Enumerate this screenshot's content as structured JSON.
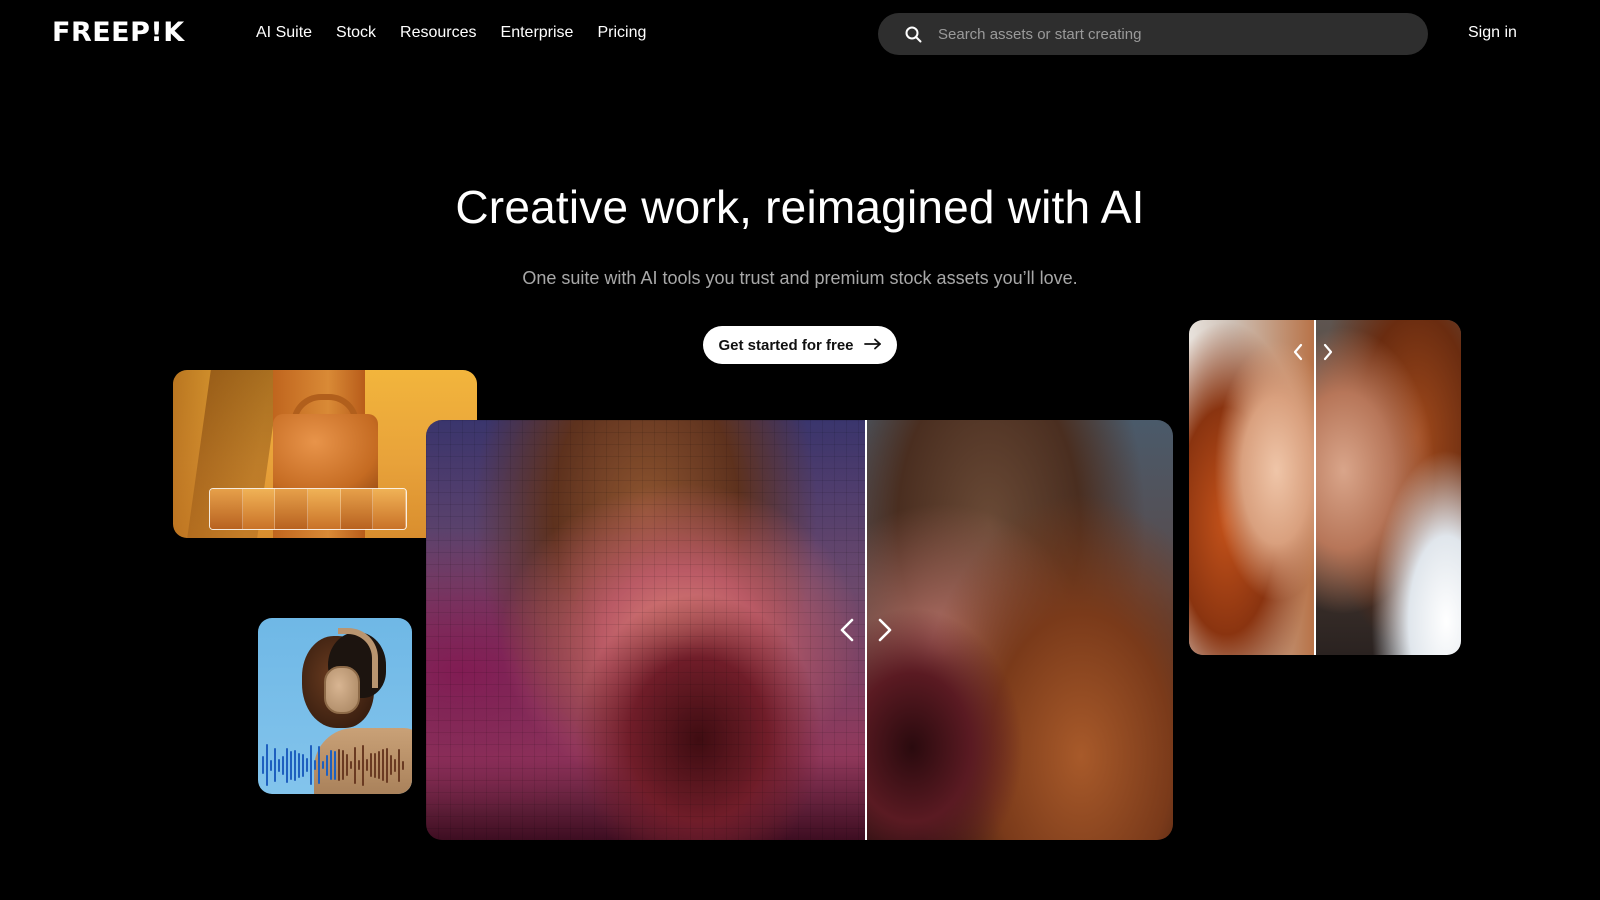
{
  "header": {
    "logo": "FREEP!K",
    "nav": [
      {
        "label": "AI Suite"
      },
      {
        "label": "Stock"
      },
      {
        "label": "Resources"
      },
      {
        "label": "Enterprise"
      },
      {
        "label": "Pricing"
      }
    ],
    "search": {
      "placeholder": "Search assets or start creating",
      "icon": "search-icon"
    },
    "sign_in": "Sign in"
  },
  "hero": {
    "title": "Creative work, reimagined with AI",
    "subtitle": "One suite with AI tools you trust and premium stock assets you’ll love.",
    "cta": {
      "label": "Get started for free",
      "icon": "arrow-right-icon"
    }
  },
  "colors": {
    "background": "#000000",
    "text": "#ffffff",
    "subtitle": "#a8a8a8",
    "search_bg": "#2e2e2e",
    "cta_bg": "#ffffff",
    "cta_text": "#111111"
  },
  "showcase": {
    "cards": [
      {
        "name": "bag-product-card",
        "content": "orange leather bag with variation thumbnails"
      },
      {
        "name": "headphones-audio-card",
        "content": "person wearing headphones with audio waveform"
      },
      {
        "name": "upscale-comparison-card",
        "content": "before/after upscale comparison slider"
      },
      {
        "name": "portrait-comparison-card",
        "content": "before/after portrait comparison slider"
      }
    ]
  }
}
